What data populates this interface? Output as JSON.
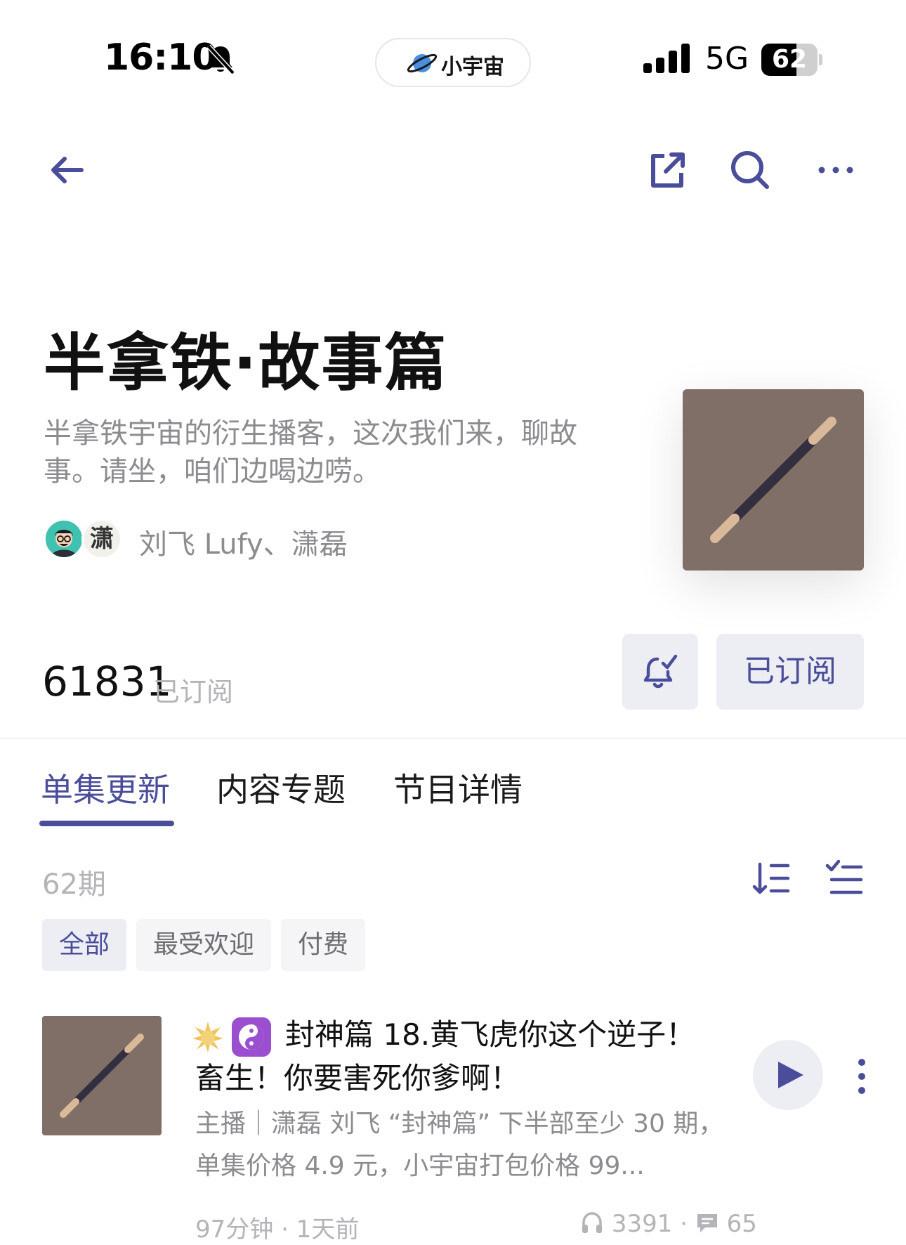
{
  "status_bar": {
    "time": "16:10",
    "app_pill_label": "小宇宙",
    "network": "5G",
    "battery_level": "62",
    "battery_fraction": 0.62
  },
  "icons": {
    "back": "arrow-left-icon",
    "share": "share-external-icon",
    "search": "search-icon",
    "more": "more-horizontal-icon",
    "bell": "bell-icon",
    "sort": "sort-order-icon",
    "list": "checklist-icon",
    "play": "play-icon",
    "listens": "headphones-icon",
    "comments": "comment-icon"
  },
  "podcast": {
    "title": "半拿铁·故事篇",
    "description": "半拿铁宇宙的衍生播客，这次我们来，聊故事。请坐，咱们边喝边唠。",
    "hosts_label": "刘飞 Lufy、潇磊",
    "avatar_2_glyph": "潇"
  },
  "subscribe": {
    "count": "61831",
    "count_label": "已订阅",
    "button_label": "已订阅"
  },
  "tabs": [
    {
      "label": "单集更新",
      "active": true
    },
    {
      "label": "内容专题",
      "active": false
    },
    {
      "label": "节目详情",
      "active": false
    }
  ],
  "episodes_header": {
    "count": "62期"
  },
  "filters": [
    {
      "label": "全部",
      "active": true
    },
    {
      "label": "最受欢迎",
      "active": false
    },
    {
      "label": "付费",
      "active": false
    }
  ],
  "episode": {
    "title": "封神篇 18.黄飞虎你这个逆子！畜生！你要害死你爹啊！",
    "description": "主播｜潇磊 刘飞 “封神篇” 下半部至少 30 期，单集价格 4.9 元，小宇宙打包价格 99...",
    "duration_age": "97分钟 · 1天前",
    "listens": "3391",
    "stats_separator": " · ",
    "comments": "65"
  },
  "colors": {
    "accent": "#4a4e9a",
    "chip_background": "#ededf4",
    "cover_brown": "#7f6f66",
    "muted_text": "#8b8b90"
  }
}
